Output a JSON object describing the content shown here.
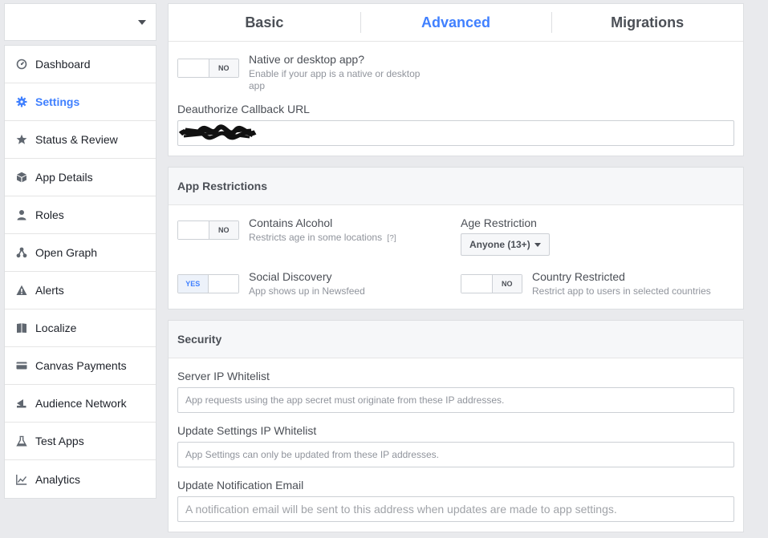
{
  "sidebar": {
    "items": [
      {
        "label": "Dashboard",
        "icon": "dashboard-icon"
      },
      {
        "label": "Settings",
        "icon": "gear-icon",
        "active": true
      },
      {
        "label": "Status & Review",
        "icon": "star-icon"
      },
      {
        "label": "App Details",
        "icon": "cube-icon"
      },
      {
        "label": "Roles",
        "icon": "person-icon"
      },
      {
        "label": "Open Graph",
        "icon": "graph-icon"
      },
      {
        "label": "Alerts",
        "icon": "warning-icon"
      },
      {
        "label": "Localize",
        "icon": "book-icon"
      },
      {
        "label": "Canvas Payments",
        "icon": "card-icon"
      },
      {
        "label": "Audience Network",
        "icon": "megaphone-icon"
      },
      {
        "label": "Test Apps",
        "icon": "flask-icon"
      },
      {
        "label": "Analytics",
        "icon": "chart-icon"
      }
    ]
  },
  "tabs": [
    {
      "label": "Basic"
    },
    {
      "label": "Advanced",
      "active": true
    },
    {
      "label": "Migrations"
    }
  ],
  "advanced": {
    "native": {
      "toggle": "NO",
      "title": "Native or desktop app?",
      "desc": "Enable if your app is a native or desktop app"
    },
    "deauth_label": "Deauthorize Callback URL"
  },
  "restrictions": {
    "heading": "App Restrictions",
    "alcohol": {
      "toggle": "NO",
      "title": "Contains Alcohol",
      "desc": "Restricts age in some locations",
      "help": "[?]"
    },
    "age": {
      "title": "Age Restriction",
      "value": "Anyone (13+)"
    },
    "social": {
      "toggle": "YES",
      "title": "Social Discovery",
      "desc": "App shows up in Newsfeed"
    },
    "country": {
      "toggle": "NO",
      "title": "Country Restricted",
      "desc": "Restrict app to users in selected countries"
    }
  },
  "security": {
    "heading": "Security",
    "server_ip": {
      "label": "Server IP Whitelist",
      "placeholder": "App requests using the app secret must originate from these IP addresses."
    },
    "update_ip": {
      "label": "Update Settings IP Whitelist",
      "placeholder": "App Settings can only be updated from these IP addresses."
    },
    "notify_email": {
      "label": "Update Notification Email",
      "placeholder": "A notification email will be sent to this address when updates are made to app settings."
    }
  },
  "colors": {
    "accent": "#4080ff",
    "background": "#e9eaed"
  }
}
